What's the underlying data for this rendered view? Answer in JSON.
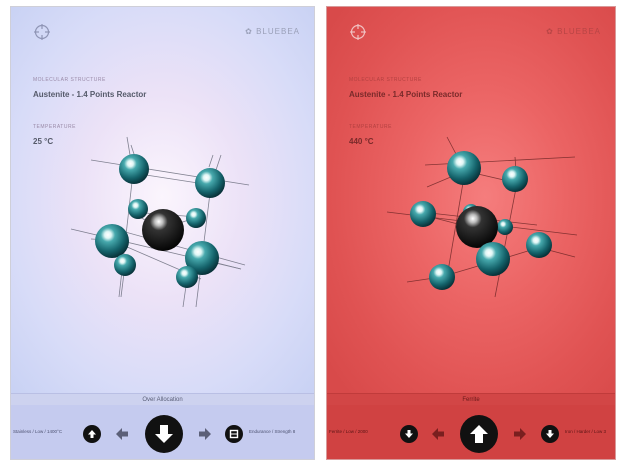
{
  "screens": [
    {
      "brand": "✿ BLUEBEA",
      "structure_label": "MOLECULAR STRUCTURE",
      "structure_value": "Austenite - 1.4 Points Reactor",
      "temperature_label": "TEMPERATURE",
      "temperature_value": "25 °C",
      "strip_text": "Over Allocation",
      "left_text": "Stainless / Low / 1400°C",
      "right_text": "Endurance / Strength 8",
      "main_icon": "arrow-down-icon"
    },
    {
      "brand": "✿ BLUEBEA",
      "structure_label": "MOLECULAR STRUCTURE",
      "structure_value": "Austenite - 1.4 Points Reactor",
      "temperature_label": "TEMPERATURE",
      "temperature_value": "440 °C",
      "strip_text": "Ferrite",
      "left_text": "Ferrite / Low / 2000",
      "right_text": "Iron / Harder / Low 3",
      "main_icon": "arrow-up-icon"
    }
  ],
  "colors": {
    "cool_background": "#d8dcf8",
    "hot_background": "#eb6464",
    "atom_teal": "#1f7c82",
    "atom_center": "#111111"
  }
}
